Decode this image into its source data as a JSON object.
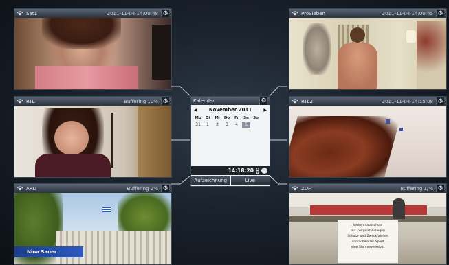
{
  "panels": {
    "sat1": {
      "title": "Sat1",
      "right": "2011-11-04 14:00:48"
    },
    "pro7": {
      "title": "ProSieben",
      "right": "2011-11-04 14:00:45"
    },
    "rtl": {
      "title": "RTL",
      "right": "Buffering 10%"
    },
    "rtl2": {
      "title": "RTL2",
      "right": "2011-11-04 14:15:08"
    },
    "ard": {
      "title": "ARD",
      "right": "Buffering 2%"
    },
    "zdf": {
      "title": "ZDF",
      "right": "Buffering 1/%"
    }
  },
  "overlays": {
    "ard_lower_third": "Nina Sauer",
    "zdf_sign_line1": "Verkehrsausschuss",
    "zdf_sign_line2": "mit Zeitgeist-Anliegen",
    "zdf_sign_line3": "Schutz- und Zweckfahrten",
    "zdf_sign_line4": "von Schweizer Spielf",
    "zdf_sign_line5": "eine Stammwerkstatt"
  },
  "calendar": {
    "title": "Kalender",
    "month": "November 2011",
    "prev": "◀",
    "next": "▶",
    "weekdays": [
      "Mo",
      "Di",
      "Mi",
      "Do",
      "Fr",
      "Sa",
      "So"
    ],
    "days": [
      "31",
      "1",
      "2",
      "3",
      "4",
      "5",
      ""
    ],
    "selected_day": "5",
    "time": "14:18:20",
    "record_label": "Aufzeichnung",
    "live_label": "Live"
  },
  "colors": {
    "accent": "#4d5a6a",
    "background": "#1a222c"
  }
}
